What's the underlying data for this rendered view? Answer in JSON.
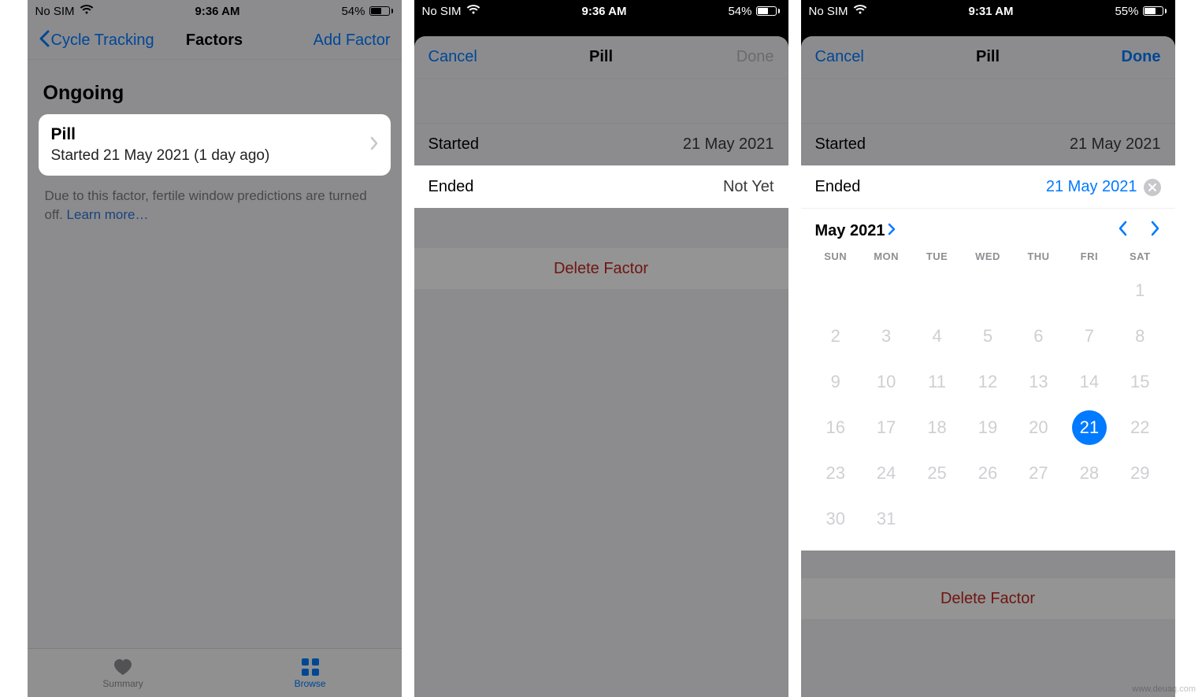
{
  "watermark": "www.deuaq.com",
  "phone1": {
    "status": {
      "carrier": "No SIM",
      "time": "9:36 AM",
      "battery": "54%"
    },
    "nav": {
      "back": "Cycle Tracking",
      "title": "Factors",
      "action": "Add Factor"
    },
    "section_header": "Ongoing",
    "cell": {
      "title": "Pill",
      "subtitle": "Started 21 May 2021 (1 day ago)"
    },
    "footer": {
      "text": "Due to this factor, fertile window predictions are turned off. ",
      "link": "Learn more…"
    },
    "tabs": {
      "summary": "Summary",
      "browse": "Browse"
    }
  },
  "phone2": {
    "status": {
      "carrier": "No SIM",
      "time": "9:36 AM",
      "battery": "54%"
    },
    "sheet": {
      "cancel": "Cancel",
      "title": "Pill",
      "done": "Done"
    },
    "rows": {
      "started_label": "Started",
      "started_value": "21 May 2021",
      "ended_label": "Ended",
      "ended_value": "Not Yet"
    },
    "delete": "Delete Factor"
  },
  "phone3": {
    "status": {
      "carrier": "No SIM",
      "time": "9:31 AM",
      "battery": "55%"
    },
    "sheet": {
      "cancel": "Cancel",
      "title": "Pill",
      "done": "Done"
    },
    "rows": {
      "started_label": "Started",
      "started_value": "21 May 2021",
      "ended_label": "Ended",
      "ended_value": "21 May 2021"
    },
    "calendar": {
      "month_label": "May 2021",
      "dow": [
        "SUN",
        "MON",
        "TUE",
        "WED",
        "THU",
        "FRI",
        "SAT"
      ],
      "leading_blanks": 6,
      "days": 31,
      "selected": 21
    },
    "delete": "Delete Factor"
  }
}
